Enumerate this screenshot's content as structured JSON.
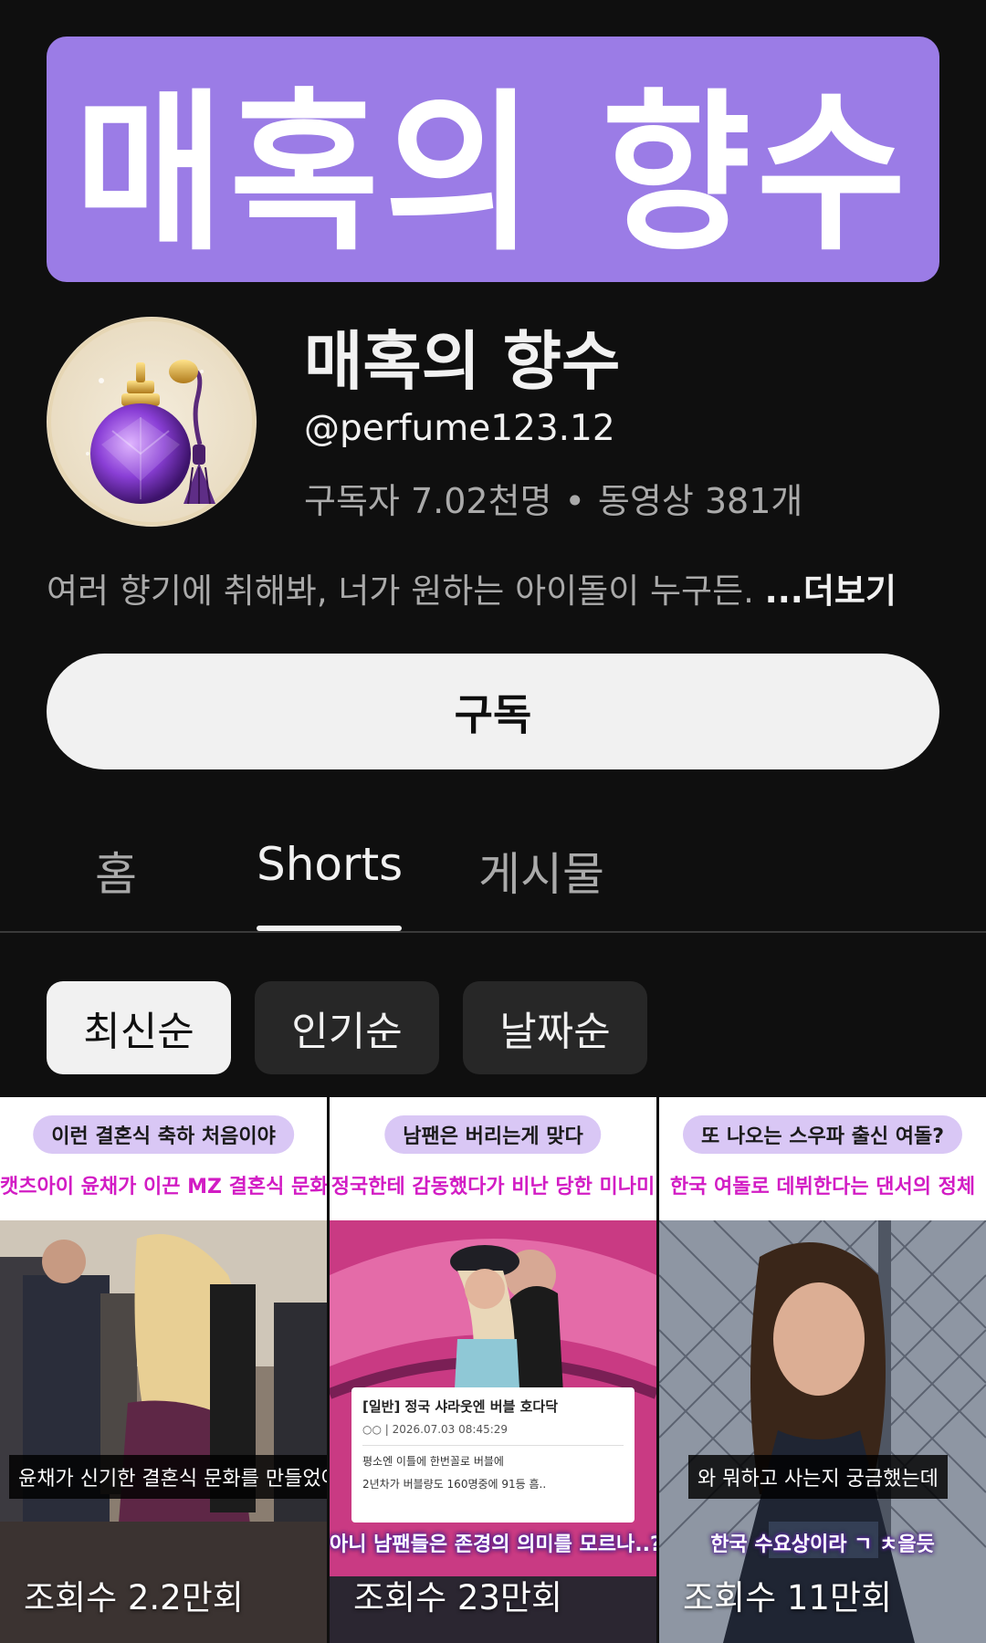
{
  "banner": {
    "text": "매혹의 향수"
  },
  "channel": {
    "name": "매혹의 향수",
    "handle": "@perfume123.12",
    "subscribers": "구독자 7.02천명",
    "separator": "•",
    "videos": "동영상 381개",
    "description": "여러 향기에 취해봐, 너가 원하는 아이돌이 누구든. ",
    "more_label": "...더보기",
    "avatar_icon": "perfume-bottle-icon"
  },
  "subscribe_label": "구독",
  "tabs": [
    {
      "label": "홈",
      "active": false
    },
    {
      "label": "Shorts",
      "active": true
    },
    {
      "label": "게시물",
      "active": false
    }
  ],
  "chips": [
    {
      "label": "최신순",
      "selected": true
    },
    {
      "label": "인기순",
      "selected": false
    },
    {
      "label": "날짜순",
      "selected": false
    }
  ],
  "shorts": [
    {
      "header": "이런 결혼식 축하 처음이야",
      "title": "캣츠아이 윤채가 이끈 MZ 결혼식 문화",
      "caption": "윤채가 신기한 결혼식 문화를 만들었어요",
      "views": "조회수 2.2만회"
    },
    {
      "header": "남팬은 버리는게 맞다",
      "title": "정국한테 감동했다가 비난 당한 미나미",
      "post_title": "[일반] 정국 샤라웃엔 버블 호다닥",
      "post_meta": "○○ | 2026.07.03 08:45:29",
      "post_line1": "평소엔 이틀에 한번꼴로 버블에",
      "post_line2": "2년차가 버블량도 160명중에 91등 흠..",
      "overlay": "아니 남팬들은 존경의 의미를 모르나..?",
      "views": "조회수 23만회"
    },
    {
      "header": "또 나오는 스우파 출신 여돌?",
      "title": "한국 여돌로 데뷔한다는 댄서의 정체",
      "caption": "와 뭐하고 사는지 궁금했는데",
      "overlay": "한국 수요상이라 ㄱ ㅊ을듯",
      "views": "조회수 11만회"
    }
  ],
  "colors": {
    "background": "#0f0f0f",
    "banner": "#9b7ce6",
    "header_pill": "#d9c7f5",
    "title_magenta": "#d21cc4"
  }
}
